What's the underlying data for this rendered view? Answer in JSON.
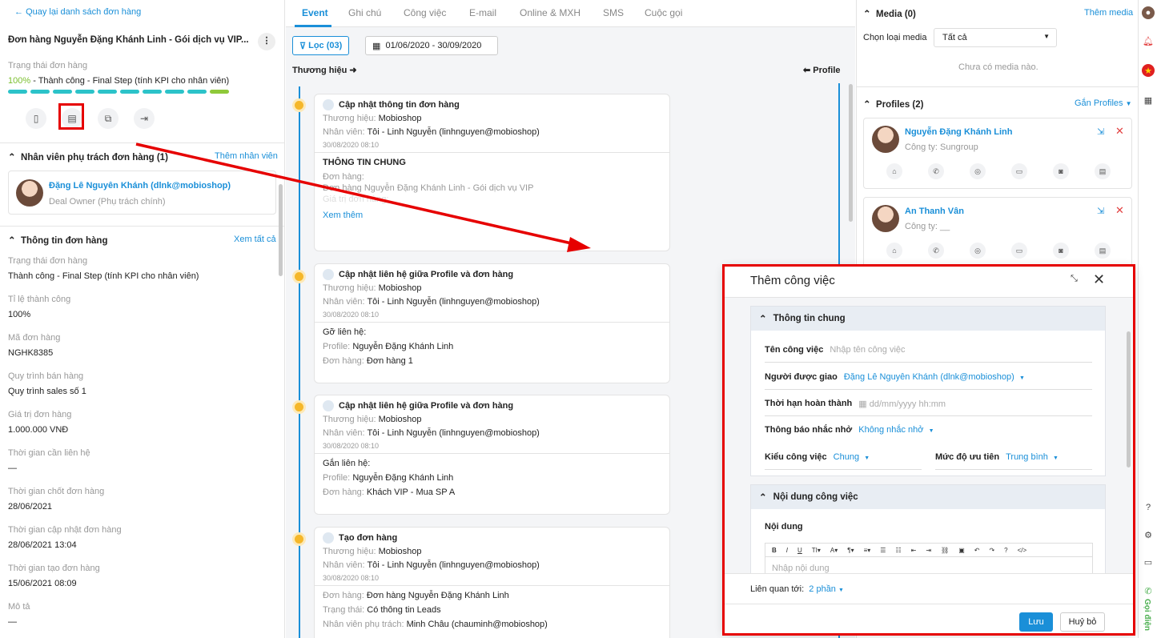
{
  "left": {
    "back_label": "Quay lại danh sách đơn hàng",
    "title": "Đơn hàng Nguyễn Đặng Khánh Linh - Gói dịch vụ VIP...",
    "status_label": "Trạng thái đơn hàng",
    "status_percent": "100%",
    "status_text": " - Thành công - Final Step (tính KPI cho nhân viên)",
    "progress_steps": 10,
    "staff_section": "Nhân viên phụ trách đơn hàng (1)",
    "add_staff": "Thêm nhân viên",
    "staff_name": "Đặng Lê Nguyên Khánh (dlnk@mobioshop)",
    "staff_role": "Deal Owner (Phụ trách chính)",
    "info_section": "Thông tin đơn hàng",
    "see_all": "Xem tất cả",
    "fields": [
      {
        "label": "Trạng thái đơn hàng",
        "value": "Thành công - Final Step (tính KPI cho nhân viên)"
      },
      {
        "label": "Tỉ lệ thành công",
        "value": "100%"
      },
      {
        "label": "Mã đơn hàng",
        "value": "NGHK8385"
      },
      {
        "label": "Quy trình bán hàng",
        "value": "Quy trình sales số 1"
      },
      {
        "label": "Giá trị đơn hàng",
        "value": "1.000.000 VNĐ"
      },
      {
        "label": "Thời gian cần liên hệ",
        "value": "—"
      },
      {
        "label": "Thời gian chốt đơn hàng",
        "value": "28/06/2021"
      },
      {
        "label": "Thời gian cập nhật đơn hàng",
        "value": "28/06/2021 13:04"
      },
      {
        "label": "Thời gian tạo đơn hàng",
        "value": "15/06/2021 08:09"
      },
      {
        "label": "Mô tả",
        "value": "—"
      }
    ]
  },
  "mid": {
    "tabs": [
      "Event",
      "Ghi chú",
      "Công việc",
      "E-mail",
      "Online & MXH",
      "SMS",
      "Cuộc gọi"
    ],
    "filter_label": "Lọc (03)",
    "date_range": "01/06/2020 - 30/09/2020",
    "brand_label": "Thương hiệu",
    "profile_label": "Profile",
    "cards": [
      {
        "title": "Cập nhật thông tin đơn hàng",
        "brand_k": "Thương hiệu:",
        "brand_v": "Mobioshop",
        "staff_k": "Nhân viên:",
        "staff_v": "Tôi - Linh Nguyễn (linhnguyen@mobioshop)",
        "time": "30/08/2020 08:10",
        "body_title": "THÔNG TIN CHUNG",
        "body_l1": "Đơn hàng:",
        "body_l2": "Đơn hàng Nguyễn Đặng Khánh Linh - Gói dịch vụ VIP",
        "body_l3": "Giá trị đơn hàng:",
        "more": "Xem thêm"
      },
      {
        "title": "Cập nhật liên hệ giữa Profile và đơn hàng",
        "brand_k": "Thương hiệu:",
        "brand_v": "Mobioshop",
        "staff_k": "Nhân viên:",
        "staff_v": "Tôi - Linh Nguyễn (linhnguyen@mobioshop)",
        "time": "30/08/2020 08:10",
        "body_title": "Gỡ liên hệ:",
        "p_k": "Profile:",
        "p_v": "Nguyễn Đặng Khánh Linh",
        "o_k": "Đơn hàng:",
        "o_v": "Đơn hàng 1"
      },
      {
        "title": "Cập nhật liên hệ giữa Profile và đơn hàng",
        "brand_k": "Thương hiệu:",
        "brand_v": "Mobioshop",
        "staff_k": "Nhân viên:",
        "staff_v": "Tôi - Linh Nguyễn (linhnguyen@mobioshop)",
        "time": "30/08/2020 08:10",
        "body_title": "Gắn liên hệ:",
        "p_k": "Profile:",
        "p_v": "Nguyễn Đặng Khánh Linh",
        "o_k": "Đơn hàng:",
        "o_v": "Khách VIP - Mua SP A"
      },
      {
        "title": "Tạo đơn hàng",
        "brand_k": "Thương hiệu:",
        "brand_v": "Mobioshop",
        "staff_k": "Nhân viên:",
        "staff_v": "Tôi - Linh Nguyễn (linhnguyen@mobioshop)",
        "time": "30/08/2020 08:10",
        "o_k": "Đơn hàng:",
        "o_v": "Đơn hàng Nguyễn Đặng Khánh Linh",
        "s_k": "Trạng thái:",
        "s_v": "Có thông tin Leads",
        "r_k": "Nhân viên phụ trách:",
        "r_v": "Minh Châu (chauminh@mobioshop)"
      }
    ]
  },
  "right": {
    "media_title": "Media (0)",
    "media_add": "Thêm media",
    "media_type_label": "Chọn loại media",
    "media_type_value": "Tất cả",
    "media_empty": "Chưa có media nào.",
    "profiles_title": "Profiles (2)",
    "profiles_attach": "Gắn Profiles",
    "profiles": [
      {
        "name": "Nguyễn Đặng Khánh Linh",
        "company": "Công ty: Sungroup"
      },
      {
        "name": "An Thanh Vân",
        "company": "Công ty: __"
      }
    ]
  },
  "rail": {
    "call_label": "Gọi điện"
  },
  "modal": {
    "title": "Thêm công việc",
    "section1": "Thông tin chung",
    "task_name_label": "Tên công việc",
    "task_name_placeholder": "Nhập tên công việc",
    "assignee_label": "Người được giao",
    "assignee_value": "Đặng Lê Nguyên Khánh (dlnk@mobioshop)",
    "deadline_label": "Thời hạn hoàn thành",
    "deadline_placeholder": "dd/mm/yyyy hh:mm",
    "reminder_label": "Thông báo nhắc nhở",
    "reminder_value": "Không nhắc nhở",
    "type_label": "Kiểu công việc",
    "type_value": "Chung",
    "priority_label": "Mức độ ưu tiên",
    "priority_value": "Trung bình",
    "section2": "Nội dung công việc",
    "content_label": "Nội dung",
    "content_placeholder": "Nhập nội dung",
    "related_label": "Liên quan tới:",
    "related_value": "2 phần",
    "save": "Lưu",
    "cancel": "Huỷ bỏ"
  },
  "colors": {
    "accent": "#1a8fd8",
    "progress": "#2cc3c9",
    "progress_last": "#8fc93a",
    "highlight": "#e60000",
    "event_dot": "#f5b72a"
  }
}
